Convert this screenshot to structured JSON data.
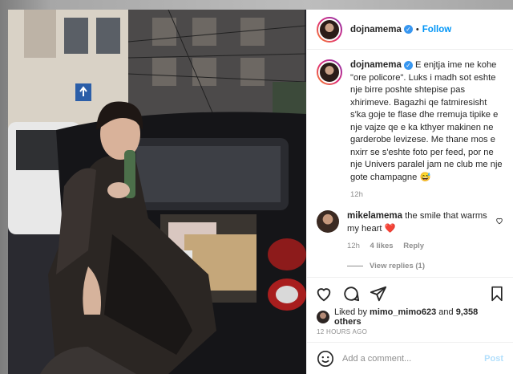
{
  "post": {
    "username": "dojnamema",
    "follow_label": "Follow",
    "separator": "•"
  },
  "caption": {
    "username": "dojnamema",
    "text": "E enjtja ime ne kohe \"ore policore\". Luks i madh sot eshte nje birre poshte shtepise pas xhirimeve. Bagazhi qe fatmiresisht s'ka goje te flase dhe rremuja tipike e nje vajze qe e ka kthyer makinen ne garderobe levizese. Me thane mos e nxirr se s'eshte foto per feed, por ne nje Univers paralel jam ne club me nje gote champagne 😅",
    "time": "12h"
  },
  "comment": {
    "username": "mikelamema",
    "text": "the smile that warms my heart",
    "emoji": "❤️",
    "time": "12h",
    "likes": "4 likes",
    "reply_label": "Reply",
    "view_replies": "View replies (1)"
  },
  "likes": {
    "prefix": "Liked by",
    "user": "mimo_mimo623",
    "middle": "and",
    "count": "9,358 others"
  },
  "timestamp": "12 HOURS AGO",
  "add_comment": {
    "placeholder": "Add a comment...",
    "post_label": "Post"
  },
  "icons": [
    "heart-icon",
    "comment-icon",
    "share-icon",
    "bookmark-icon",
    "emoji-icon"
  ],
  "colors": {
    "link_blue": "#0095f6",
    "verified": "#3897f0",
    "muted": "#8e8e8e",
    "post_disabled": "#b2dffc"
  }
}
